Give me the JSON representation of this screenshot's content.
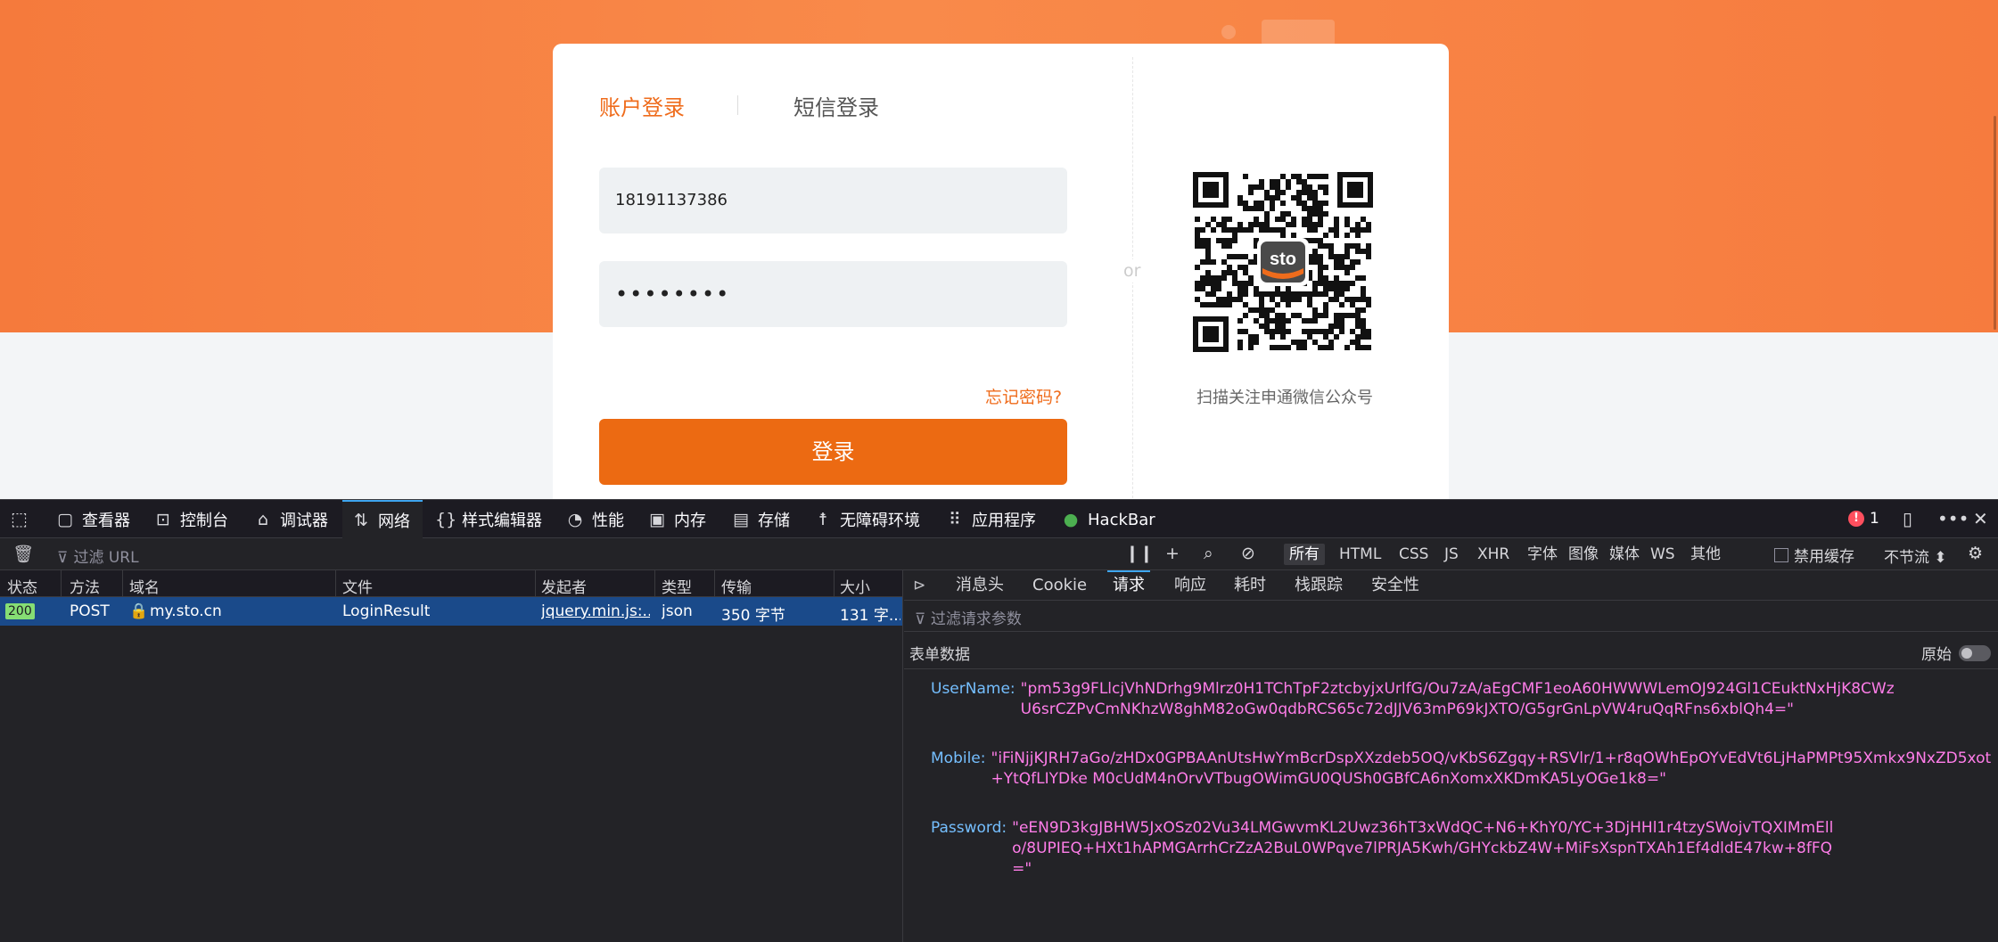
{
  "page": {
    "tabs": {
      "account": "账户登录",
      "sms": "短信登录"
    },
    "username_value": "18191137386",
    "password_value": "••••••••",
    "forgot_password": "忘记密码?",
    "login_button": "登录",
    "or_label": "or",
    "qr_caption": "扫描关注申通微信公众号",
    "qr_logo": "sto"
  },
  "devtools": {
    "tabs": [
      {
        "label": "查看器",
        "icon": "inspector-icon"
      },
      {
        "label": "控制台",
        "icon": "console-icon"
      },
      {
        "label": "调试器",
        "icon": "debugger-icon"
      },
      {
        "label": "网络",
        "icon": "network-icon"
      },
      {
        "label": "样式编辑器",
        "icon": "style-editor-icon"
      },
      {
        "label": "性能",
        "icon": "performance-icon"
      },
      {
        "label": "内存",
        "icon": "memory-icon"
      },
      {
        "label": "存储",
        "icon": "storage-icon"
      },
      {
        "label": "无障碍环境",
        "icon": "accessibility-icon"
      },
      {
        "label": "应用程序",
        "icon": "application-icon"
      },
      {
        "label": "HackBar",
        "icon": "hackbar-icon"
      }
    ],
    "error_count": "1",
    "filter_placeholder": "过滤 URL",
    "type_filters": [
      "所有",
      "HTML",
      "CSS",
      "JS",
      "XHR",
      "字体",
      "图像",
      "媒体",
      "WS",
      "其他"
    ],
    "disable_cache": "禁用缓存",
    "throttle": "不节流 ⬍",
    "columns": [
      "状态",
      "方法",
      "域名",
      "文件",
      "发起者",
      "类型",
      "传输",
      "大小"
    ],
    "request": {
      "status": "200",
      "method": "POST",
      "domain": "my.sto.cn",
      "file": "LoginResult",
      "initiator": "jquery.min.js:...",
      "type": "json",
      "transfer": "350 字节",
      "size": "131 字..."
    },
    "detail_tabs": [
      "消息头",
      "Cookie",
      "请求",
      "响应",
      "耗时",
      "栈跟踪",
      "安全性"
    ],
    "params_filter": "过滤请求参数",
    "form_data_label": "表单数据",
    "raw_label": "原始",
    "params": [
      {
        "key": "UserName:",
        "value": "\"pm53g9FLlcjVhNDrhg9Mlrz0H1TChTpF2ztcbyjxUrlfG/Ou7zA/aEgCMF1eoA60HWWWLemOJ924Gl1CEuktNxHjK8CWzU6srCZPvCmNKhzW8ghM82oGw0qdbRCS65c72dJJV63mP69kJXTO/G5grGnLpVW4ruQqRFns6xblQh4=\""
      },
      {
        "key": "Mobile:",
        "value": "\"iFiNjjKJRH7aGo/zHDx0GPBAAnUtsHwYmBcrDspXXzdeb5OQ/vKbS6Zgqy+RSVlr/1+r8qOWhEpOYvEdVt6LjHaPMPt95Xmkx9NxZD5xot+YtQfLIYDke M0cUdM4nOrvVTbugOWimGU0QUSh0GBfCA6nXomxXKDmKA5LyOGe1k8=\""
      },
      {
        "key": "Password:",
        "value": "\"eEN9D3kgJBHW5JxOSz02Vu34LMGwvmKL2Uwz36hT3xWdQC+N6+KhY0/YC+3DjHHl1r4tzySWojvTQXIMmEllo/8UPIEQ+HXt1hAPMGArrhCrZzA2BuL0WPqve7lPRJA5Kwh/GHYckbZ4W+MiFsXspnTXAh1Ef4dldE47kw+8fFQ=\""
      }
    ]
  }
}
